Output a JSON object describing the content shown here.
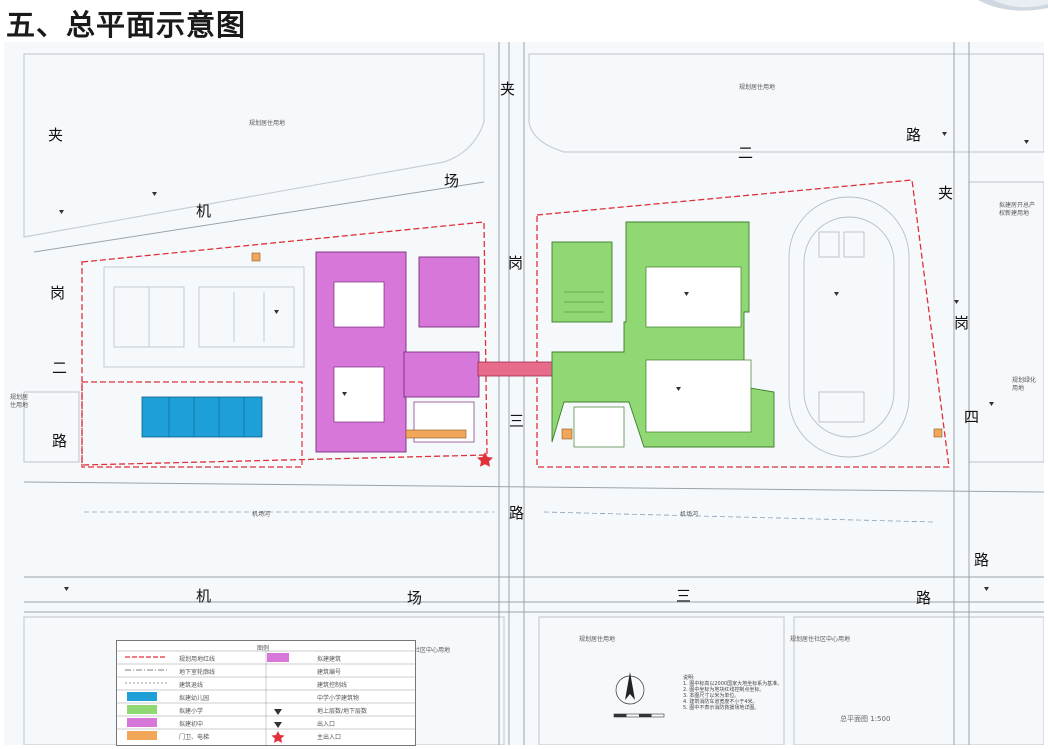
{
  "title": "五、总平面示意图",
  "roads": {
    "top_jia": "夹",
    "top_lu": "路",
    "top_er": "二",
    "left_jia": "夹",
    "left_gang": "岗",
    "left_er": "二",
    "left_lu": "路",
    "diag_ji": "机",
    "diag_chang": "场",
    "mid_gang": "岗",
    "mid_san": "三",
    "mid_lu": "路",
    "right_jia": "夹",
    "right_gang": "岗",
    "right_si": "四",
    "right_lu": "路",
    "bottom_ji": "机",
    "bottom_chang": "场",
    "bottom_san": "三",
    "bottom_lu": "路"
  },
  "labels": {
    "north_residential": "规划居住用地",
    "east_land": "拟建房开总产权新建用地",
    "west_land": "规划居住用地",
    "east_green": "规划绿化用地",
    "river_left": "机场河",
    "river_right": "机场河",
    "south_left": "规划居住社区中心用地",
    "south_mid": "规划居住用地",
    "south_right": "规划居住社区中心用地",
    "scale_title": "总平面图 1:500"
  },
  "legend": {
    "title": "图例",
    "items": [
      {
        "label": "规划用地红线",
        "right": "拟建建筑"
      },
      {
        "label": "地下室轮廓线",
        "right": "建筑编号"
      },
      {
        "label": "建筑退线",
        "right": "建筑控制线"
      },
      {
        "label": "拟建幼儿园",
        "right": "中学小学建筑物"
      },
      {
        "label": "拟建小学",
        "right": "地上层数/地下层数"
      },
      {
        "label": "拟建初中",
        "right": "出入口"
      },
      {
        "label": "门卫、电梯",
        "right": "主出入口"
      }
    ]
  },
  "notes": [
    "说明:",
    "1. 图中标高以2000国家大地坐标系为基准。",
    "2. 图中坐标为地块红线控制点坐标。",
    "3. 本图尺寸以米为单位。",
    "4. 建筑消防车道宽度不小于4米。",
    "5. 图中不表示消防救援场地详图。"
  ],
  "colors": {
    "kindergarten": "#1f9fd8",
    "primary": "#8fd873",
    "junior": "#d677d9",
    "facility": "#f2a65a",
    "redline": "#e0303a",
    "bridge": "#e86b8c",
    "background": "#f6f9fc"
  }
}
